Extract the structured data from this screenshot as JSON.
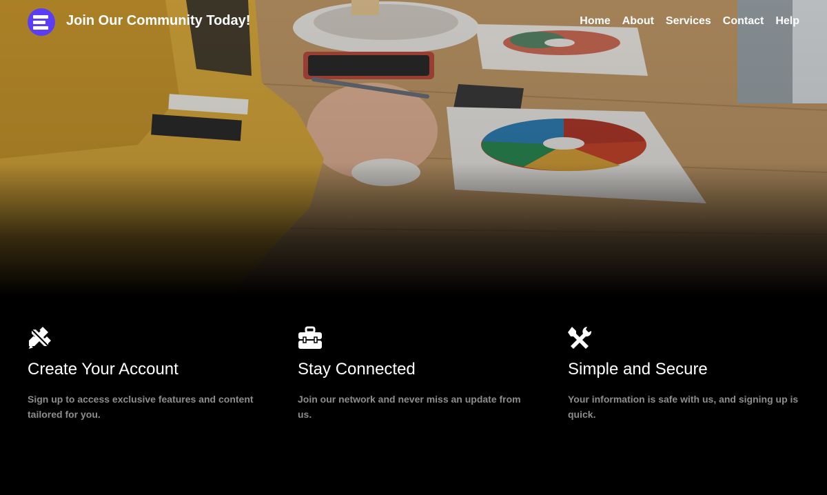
{
  "header": {
    "title": "Join Our Community Today!",
    "logo_icon": "stacked-bars-logo-icon",
    "brand_color": "#5b3df5",
    "nav": [
      {
        "label": "Home"
      },
      {
        "label": "About"
      },
      {
        "label": "Services"
      },
      {
        "label": "Contact"
      },
      {
        "label": "Help"
      }
    ]
  },
  "hero": {
    "image_alt": ""
  },
  "features": [
    {
      "icon": "pencil-ruler-icon",
      "title": "Create Your Account",
      "description": "Sign up to access exclusive features and content tailored for you."
    },
    {
      "icon": "toolbox-icon",
      "title": "Stay Connected",
      "description": "Join our network and never miss an update from us."
    },
    {
      "icon": "tools-icon",
      "title": "Simple and Secure",
      "description": "Your information is safe with us, and signing up is quick."
    }
  ]
}
